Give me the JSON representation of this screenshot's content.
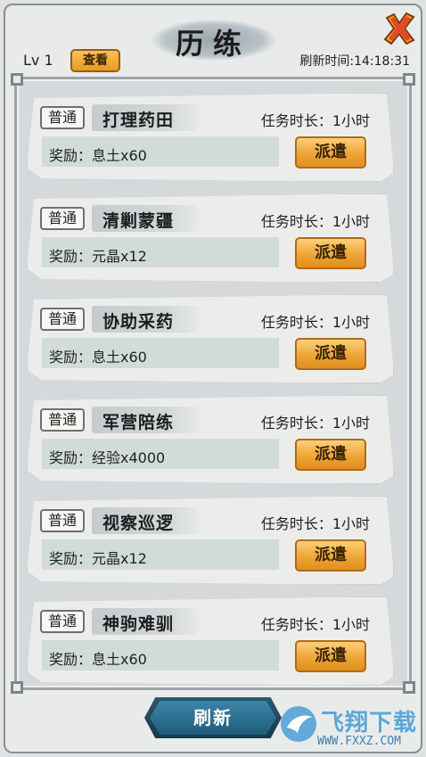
{
  "header": {
    "title": "历练",
    "level": "Lv 1",
    "view_label": "查看",
    "refresh_time": "刷新时间:14:18:31"
  },
  "tasks": [
    {
      "tier": "普通",
      "name": "打理药田",
      "duration": "任务时长：1小时",
      "reward": "奖励：息土x60",
      "action": "派遣"
    },
    {
      "tier": "普通",
      "name": "清剿蒙疆",
      "duration": "任务时长：1小时",
      "reward": "奖励：元晶x12",
      "action": "派遣"
    },
    {
      "tier": "普通",
      "name": "协助采药",
      "duration": "任务时长：1小时",
      "reward": "奖励：息土x60",
      "action": "派遣"
    },
    {
      "tier": "普通",
      "name": "军营陪练",
      "duration": "任务时长：1小时",
      "reward": "奖励：经验x4000",
      "action": "派遣"
    },
    {
      "tier": "普通",
      "name": "视察巡逻",
      "duration": "任务时长：1小时",
      "reward": "奖励：元晶x12",
      "action": "派遣"
    },
    {
      "tier": "普通",
      "name": "神驹难驯",
      "duration": "任务时长：1小时",
      "reward": "奖励：息土x60",
      "action": "派遣"
    }
  ],
  "footer": {
    "refresh_label": "刷新",
    "watermark_text": "飞翔下载",
    "watermark_url": "WWW.FXXZ.COM"
  },
  "icons": {
    "close": "close-icon",
    "watermark": "bird-logo-icon"
  },
  "colors": {
    "accent_orange": "#eea536",
    "refresh_blue": "#2d6f8f",
    "reward_bar": "#d1dcd6"
  }
}
